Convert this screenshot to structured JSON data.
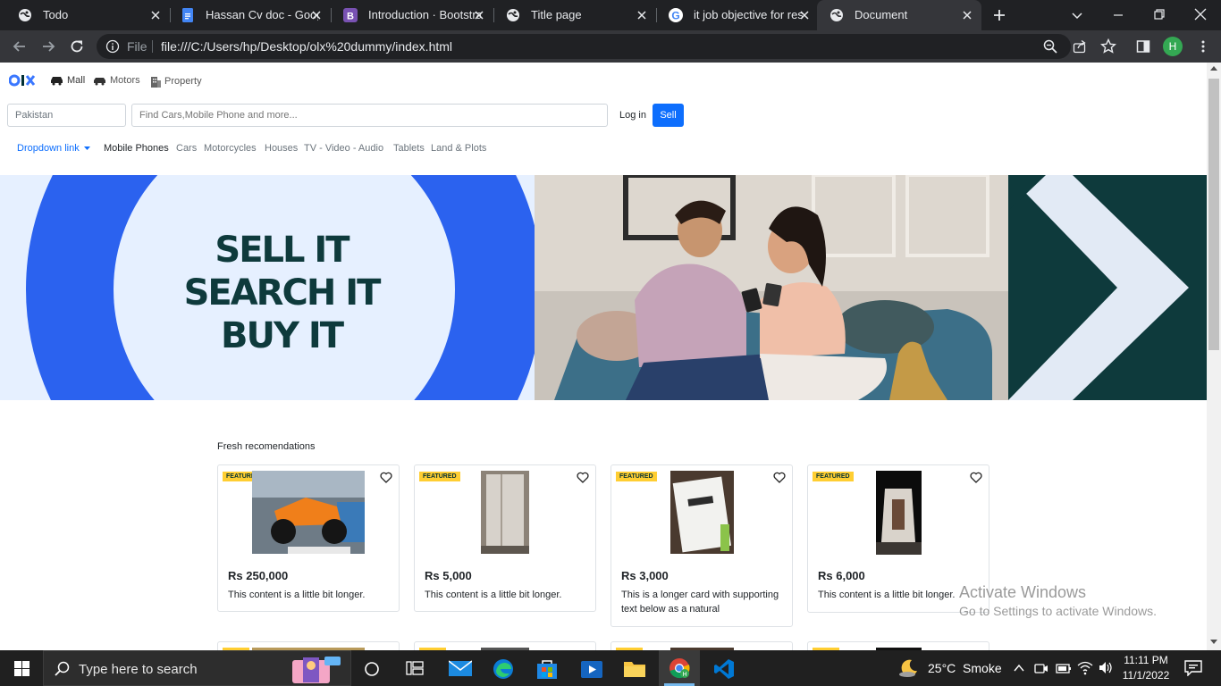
{
  "browser": {
    "tabs": [
      {
        "title": "Todo",
        "icon": "globe-icon"
      },
      {
        "title": "Hassan Cv doc - Goog",
        "icon": "google-docs-icon"
      },
      {
        "title": "Introduction · Bootstra",
        "icon": "bootstrap-icon"
      },
      {
        "title": "Title page",
        "icon": "globe-icon"
      },
      {
        "title": "it job objective for res",
        "icon": "google-icon"
      },
      {
        "title": "Document",
        "icon": "globe-icon"
      }
    ],
    "address": {
      "scheme_label": "File",
      "url": "file:///C:/Users/hp/Desktop/olx%20dummy/index.html"
    },
    "profile_initial": "H"
  },
  "site": {
    "top_nav": [
      {
        "label": "Mall",
        "icon": "car-icon"
      },
      {
        "label": "Motors",
        "icon": "car-icon"
      },
      {
        "label": "Property",
        "icon": "building-icon"
      }
    ],
    "location_value": "Pakistan",
    "search_placeholder": "Find Cars,Mobile Phone and more...",
    "login_label": "Log in",
    "sell_label": "Sell",
    "dropdown_label": "Dropdown link",
    "categories": [
      "Mobile Phones",
      "Cars",
      "Motorcycles",
      "Houses",
      "TV - Video - Audio",
      "Tablets",
      "Land & Plots"
    ],
    "hero": {
      "line1": "SELL IT",
      "line2": "SEARCH IT",
      "line3": "BUY IT"
    },
    "section_title": "Fresh recomendations",
    "cards": [
      {
        "badge": "FEATURED",
        "price": "Rs 250,000",
        "text": "This content is a little bit longer."
      },
      {
        "badge": "FEATURED",
        "price": "Rs 5,000",
        "text": "This content is a little bit longer."
      },
      {
        "badge": "FEATURED",
        "price": "Rs 3,000",
        "text": "This is a longer card with supporting text below as a natural"
      },
      {
        "badge": "FEATURED",
        "price": "Rs 6,000",
        "text": "This content is a little bit longer."
      }
    ],
    "watermark": {
      "line1": "Activate Windows",
      "line2": "Go to Settings to activate Windows."
    }
  },
  "taskbar": {
    "search_placeholder": "Type here to search",
    "weather": "25°C  Smoke",
    "time": "11:11 PM",
    "date": "11/1/2022"
  },
  "colors": {
    "accent": "#3a77ff",
    "olx_teal": "#002f34",
    "featured": "#ffce32",
    "sell_button": "#0d6efd"
  }
}
